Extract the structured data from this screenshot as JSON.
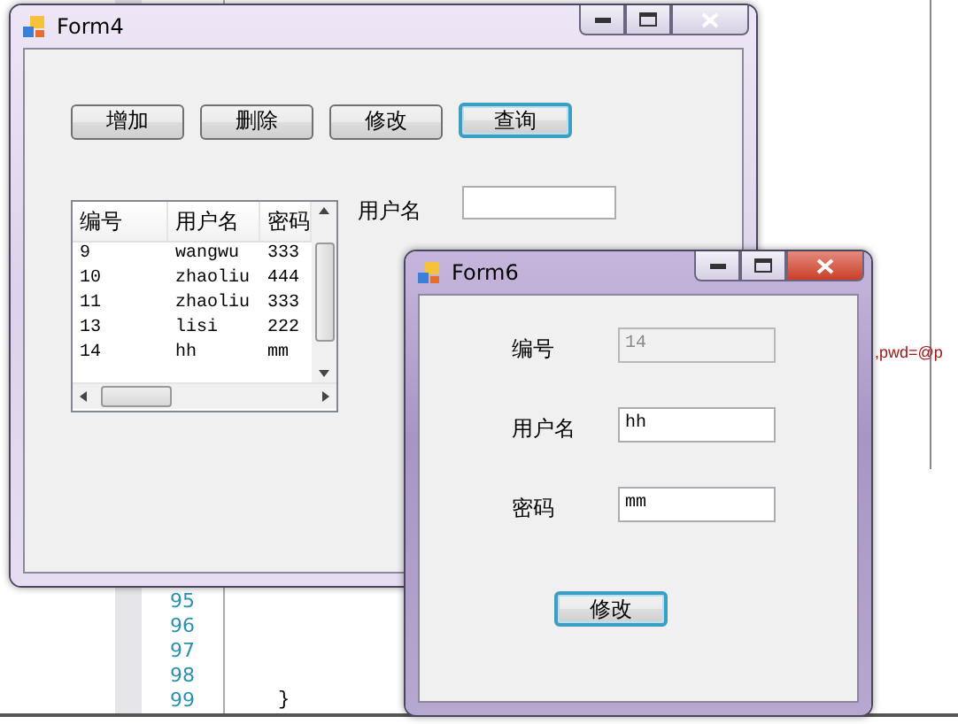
{
  "editor": {
    "line_numbers": [
      "95",
      "96",
      "97",
      "98",
      "99"
    ],
    "closing_brace": "}",
    "side_code": ",pwd=@p"
  },
  "form4": {
    "title": "Form4",
    "active": false,
    "buttons": [
      {
        "label": "增加",
        "focused": false
      },
      {
        "label": "删除",
        "focused": false
      },
      {
        "label": "修改",
        "focused": false
      },
      {
        "label": "查询",
        "focused": true
      }
    ],
    "list": {
      "columns": [
        "编号",
        "用户名",
        "密码"
      ],
      "rows": [
        [
          "9",
          "wangwu",
          "333"
        ],
        [
          "10",
          "zhaoliu",
          "444"
        ],
        [
          "11",
          "zhaoliu",
          "333"
        ],
        [
          "13",
          "lisi",
          "222"
        ],
        [
          "14",
          "hh",
          "mm"
        ]
      ]
    },
    "search_label": "用户名"
  },
  "form6": {
    "title": "Form6",
    "active": true,
    "fields": [
      {
        "label": "编号",
        "value": "14",
        "disabled": true
      },
      {
        "label": "用户名",
        "value": "hh",
        "disabled": false
      },
      {
        "label": "密码",
        "value": "mm",
        "disabled": false
      }
    ],
    "button": {
      "label": "修改",
      "focused": true
    }
  }
}
